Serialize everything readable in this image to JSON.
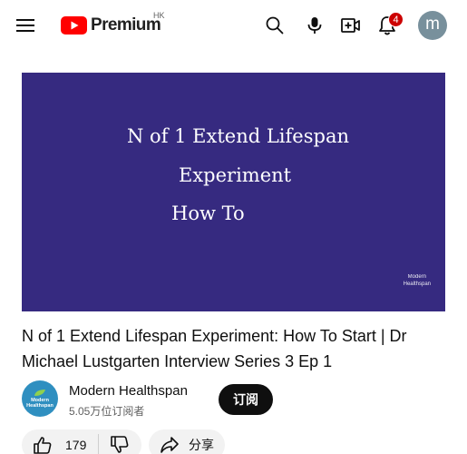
{
  "header": {
    "brand": "Premium",
    "region": "HK",
    "notification_count": "4",
    "avatar_letter": "m",
    "colors": {
      "brand_red": "#ff0000",
      "badge": "#cc0000",
      "avatar_bg": "#78909c"
    }
  },
  "player": {
    "slide_lines": [
      "N of 1 Extend Lifespan",
      "Experiment",
      "How To"
    ],
    "watermark_line1": "Modern",
    "watermark_line2": "Healthspan",
    "background": "#362a80"
  },
  "video": {
    "title": "N of 1 Extend Lifespan Experiment: How To Start | Dr Michael Lustgarten Interview Series 3 Ep 1"
  },
  "channel": {
    "avatar_line1": "Modern",
    "avatar_line2": "Healthspan",
    "name": "Modern Healthspan",
    "subscribers": "5.05万位订阅者",
    "subscribe_label": "订阅"
  },
  "actions": {
    "like_count": "179",
    "share_label": "分享"
  }
}
